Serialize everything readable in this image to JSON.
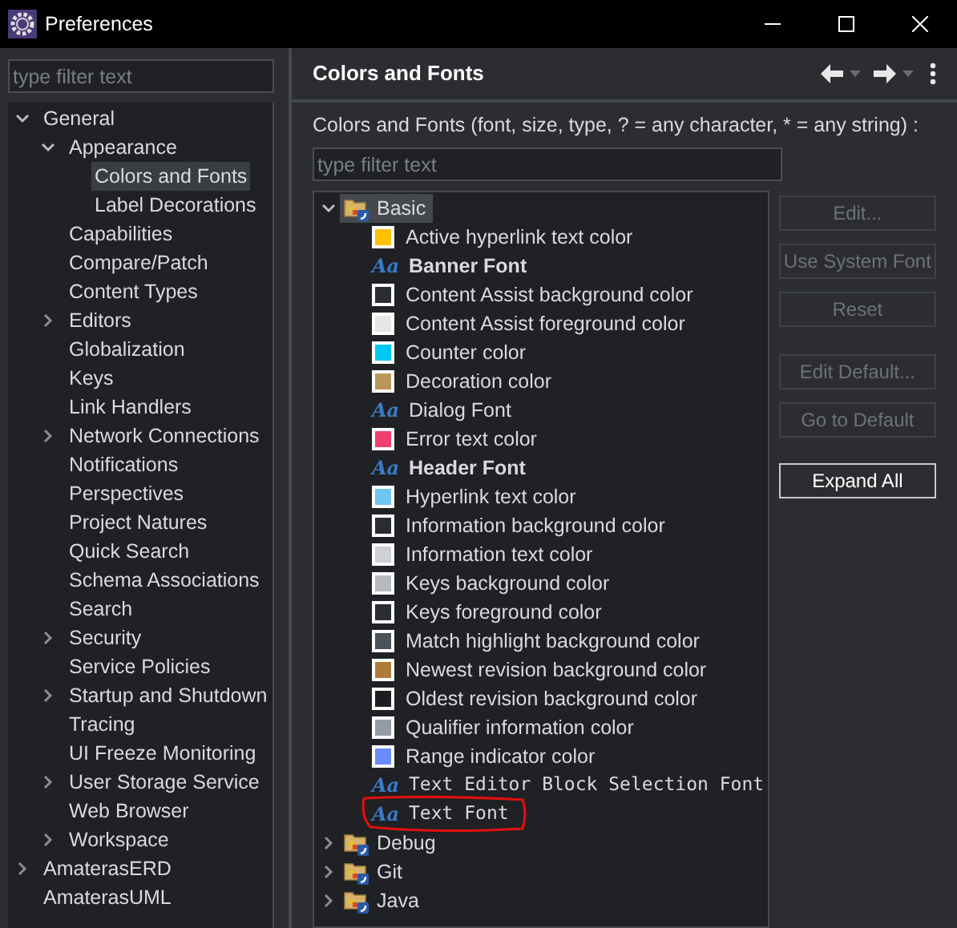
{
  "window": {
    "title": "Preferences"
  },
  "sidebar": {
    "filter": {
      "placeholder": "type filter text"
    },
    "items": [
      {
        "label": "General",
        "expanded": true,
        "selected": false,
        "children": [
          {
            "label": "Appearance",
            "expanded": true,
            "selected": false,
            "children": [
              {
                "label": "Colors and Fonts",
                "selected": true
              },
              {
                "label": "Label Decorations",
                "selected": false
              }
            ]
          },
          {
            "label": "Capabilities",
            "selected": false
          },
          {
            "label": "Compare/Patch",
            "selected": false
          },
          {
            "label": "Content Types",
            "selected": false
          },
          {
            "label": "Editors",
            "expanded": false,
            "selected": false
          },
          {
            "label": "Globalization",
            "selected": false
          },
          {
            "label": "Keys",
            "selected": false
          },
          {
            "label": "Link Handlers",
            "selected": false
          },
          {
            "label": "Network Connections",
            "expanded": false,
            "selected": false
          },
          {
            "label": "Notifications",
            "selected": false
          },
          {
            "label": "Perspectives",
            "selected": false
          },
          {
            "label": "Project Natures",
            "selected": false
          },
          {
            "label": "Quick Search",
            "selected": false
          },
          {
            "label": "Schema Associations",
            "selected": false
          },
          {
            "label": "Search",
            "selected": false
          },
          {
            "label": "Security",
            "expanded": false,
            "selected": false
          },
          {
            "label": "Service Policies",
            "selected": false
          },
          {
            "label": "Startup and Shutdown",
            "expanded": false,
            "selected": false
          },
          {
            "label": "Tracing",
            "selected": false
          },
          {
            "label": "UI Freeze Monitoring",
            "selected": false
          },
          {
            "label": "User Storage Service",
            "expanded": false,
            "selected": false
          },
          {
            "label": "Web Browser",
            "selected": false
          },
          {
            "label": "Workspace",
            "expanded": false,
            "selected": false
          }
        ]
      },
      {
        "label": "AmaterasERD",
        "expanded": false,
        "selected": false
      },
      {
        "label": "AmaterasUML",
        "selected": false
      }
    ]
  },
  "page": {
    "title": "Colors and Fonts",
    "description": "Colors and Fonts (font, size, type, ? = any character, * = any string) :",
    "filter": {
      "placeholder": "type filter text"
    },
    "tree": [
      {
        "label": "Basic",
        "expanded": true,
        "selected": true,
        "children": [
          {
            "kind": "color",
            "label": "Active hyperlink text color",
            "color": "#ffc000",
            "circled": false
          },
          {
            "kind": "bold_font",
            "icon": "Aa",
            "label": "Banner Font",
            "circled": false
          },
          {
            "kind": "color",
            "label": "Content Assist background color",
            "color": "#2a2d32",
            "circled": false
          },
          {
            "kind": "color",
            "label": "Content Assist foreground color",
            "color": "#e6e6e8",
            "circled": false
          },
          {
            "kind": "color",
            "label": "Counter color",
            "color": "#00c8f0",
            "circled": false
          },
          {
            "kind": "color",
            "label": "Decoration color",
            "color": "#b8985a",
            "circled": false
          },
          {
            "kind": "font",
            "icon": "Aa",
            "label": "Dialog Font",
            "circled": false
          },
          {
            "kind": "color",
            "label": "Error text color",
            "color": "#f04070",
            "circled": false
          },
          {
            "kind": "bold_font",
            "icon": "Aa",
            "label": "Header Font",
            "circled": false
          },
          {
            "kind": "color",
            "label": "Hyperlink text color",
            "color": "#6ec6ee",
            "circled": false
          },
          {
            "kind": "color",
            "label": "Information background color",
            "color": "#2a2d32",
            "circled": false
          },
          {
            "kind": "color",
            "label": "Information text color",
            "color": "#cdd0d4",
            "circled": false
          },
          {
            "kind": "color",
            "label": "Keys background color",
            "color": "#b6b9be",
            "circled": false
          },
          {
            "kind": "color",
            "label": "Keys foreground color",
            "color": "#2a2d32",
            "circled": false
          },
          {
            "kind": "color",
            "label": "Match highlight background color",
            "color": "#4a5158",
            "circled": false
          },
          {
            "kind": "color",
            "label": "Newest revision background color",
            "color": "#b07a38",
            "circled": false
          },
          {
            "kind": "color",
            "label": "Oldest revision background color",
            "color": "#1c1e22",
            "circled": false
          },
          {
            "kind": "color",
            "label": "Qualifier information color",
            "color": "#959ba2",
            "circled": false
          },
          {
            "kind": "color",
            "label": "Range indicator color",
            "color": "#6a8cff",
            "circled": false
          },
          {
            "kind": "mono_font",
            "icon": "Aa",
            "label": "Text Editor Block Selection Font",
            "circled": false
          },
          {
            "kind": "mono_font",
            "icon": "Aa",
            "label": "Text Font",
            "circled": true
          }
        ]
      },
      {
        "label": "Debug",
        "expanded": false,
        "selected": false
      },
      {
        "label": "Git",
        "expanded": false,
        "selected": false
      },
      {
        "label": "Java",
        "expanded": false,
        "selected": false
      }
    ],
    "buttons": [
      {
        "label": "Edit...",
        "disabled": true
      },
      {
        "label": "Use System Font",
        "disabled": true
      },
      {
        "label": "Reset",
        "disabled": true
      },
      {
        "label": "Edit Default...",
        "disabled": true
      },
      {
        "label": "Go to Default",
        "disabled": true
      },
      {
        "label": "Expand All",
        "disabled": false
      }
    ]
  }
}
